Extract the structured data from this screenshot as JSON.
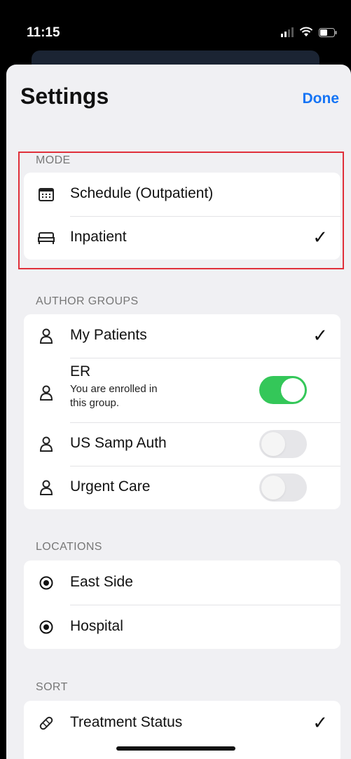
{
  "status": {
    "time": "11:15"
  },
  "header": {
    "title": "Settings",
    "done": "Done"
  },
  "mode": {
    "header": "MODE",
    "items": [
      {
        "label": "Schedule (Outpatient)",
        "selected": false
      },
      {
        "label": "Inpatient",
        "selected": true
      }
    ]
  },
  "author_groups": {
    "header": "AUTHOR GROUPS",
    "items": [
      {
        "label": "My Patients",
        "selected": true
      },
      {
        "label": "ER",
        "subtitle_line1": "You are enrolled in",
        "subtitle_line2": "this group.",
        "toggle": true
      },
      {
        "label": "US Samp Auth",
        "toggle": false
      },
      {
        "label": "Urgent Care",
        "toggle": false
      }
    ]
  },
  "locations": {
    "header": "LOCATIONS",
    "items": [
      {
        "label": "East Side"
      },
      {
        "label": "Hospital"
      }
    ]
  },
  "sort": {
    "header": "SORT",
    "items": [
      {
        "label": "Treatment Status",
        "selected": true
      }
    ]
  },
  "colors": {
    "accent": "#1574f5",
    "toggle_on": "#34c759",
    "highlight": "#e0303a"
  }
}
